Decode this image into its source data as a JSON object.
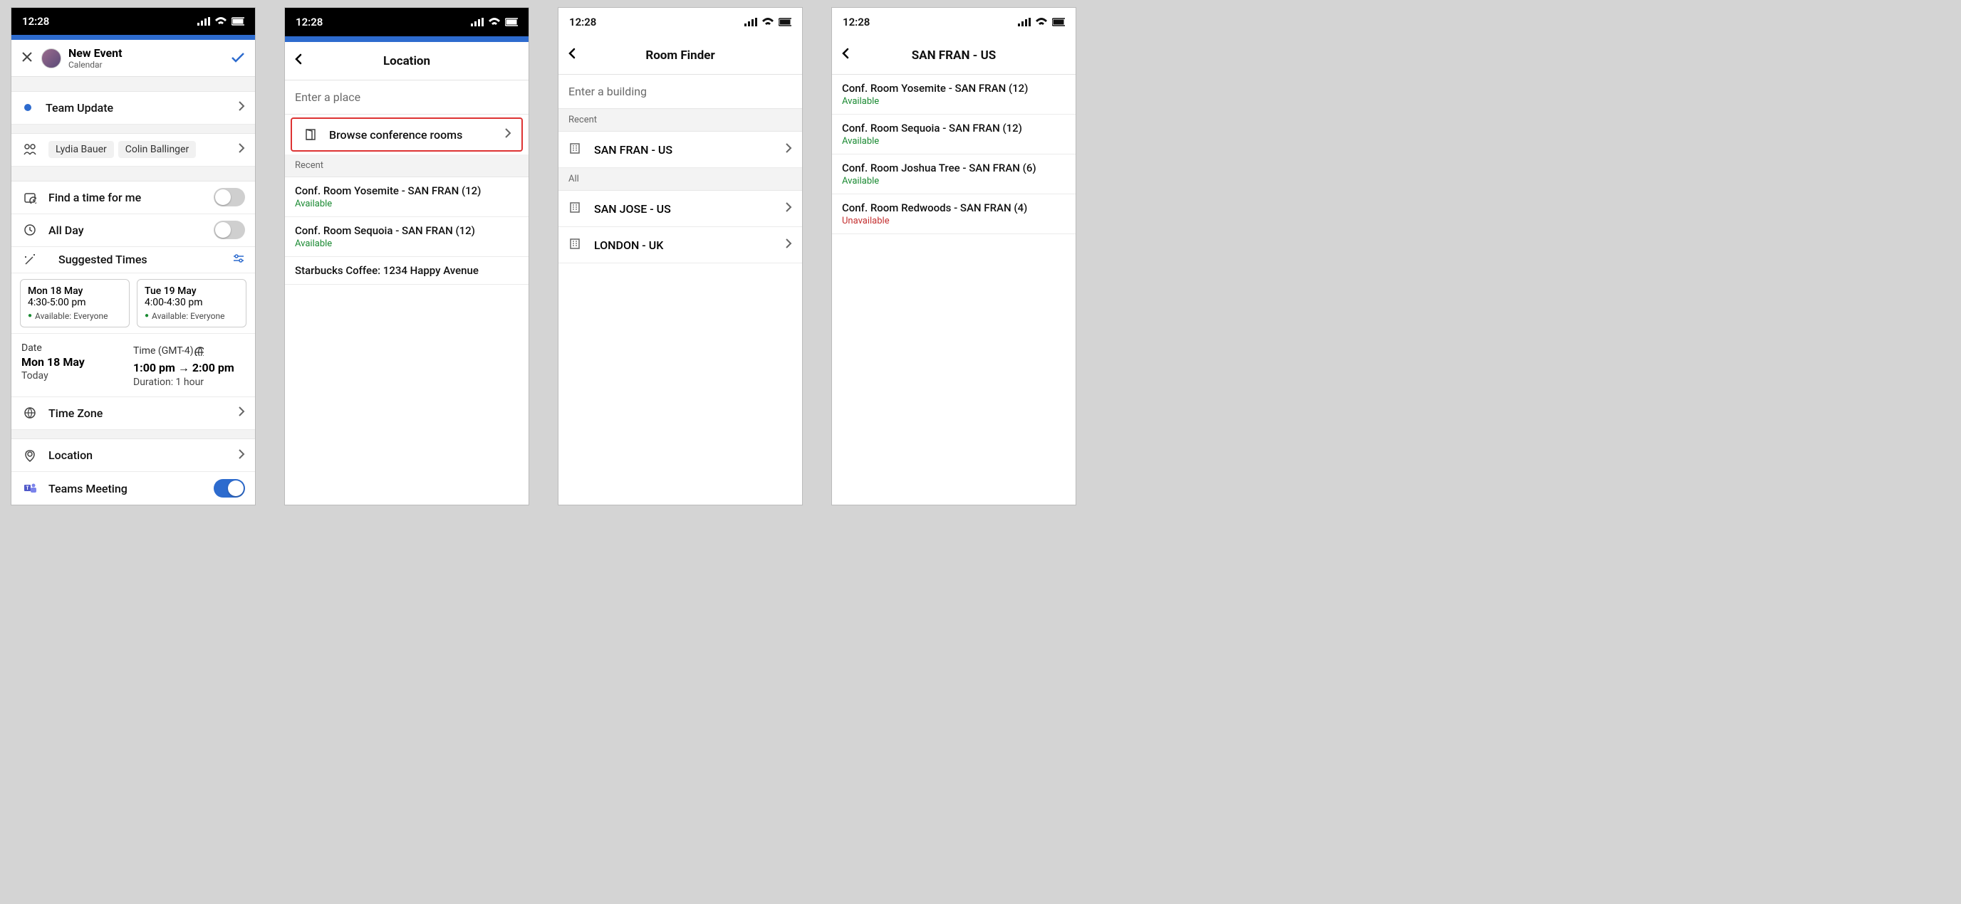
{
  "status_time": "12:28",
  "phone1": {
    "new_event_title": "New Event",
    "new_event_sub": "Calendar",
    "event_name": "Team Update",
    "attendee1": "Lydia Bauer",
    "attendee2": "Colin Ballinger",
    "find_time": "Find a time for me",
    "all_day": "All Day",
    "suggested": "Suggested Times",
    "card1_d": "Mon 18 May",
    "card1_t": "4:30-5:00 pm",
    "card1_a": "Available: Everyone",
    "card2_d": "Tue 19 May",
    "card2_t": "4:00-4:30 pm",
    "card2_a": "Available: Everyone",
    "date_label": "Date",
    "date_val": "Mon 18 May",
    "date_sub": "Today",
    "time_label": "Time (GMT-4)",
    "time_val": "1:00 pm → 2:00 pm",
    "time_sub": "Duration: 1 hour",
    "timezone": "Time Zone",
    "location": "Location",
    "teams": "Teams Meeting"
  },
  "phone2": {
    "title": "Location",
    "placeholder": "Enter a place",
    "browse": "Browse conference rooms",
    "recent": "Recent",
    "room1": "Conf. Room Yosemite - SAN FRAN (12)",
    "room1_s": "Available",
    "room2": "Conf. Room Sequoia - SAN FRAN (12)",
    "room2_s": "Available",
    "place3": "Starbucks Coffee: 1234 Happy Avenue"
  },
  "phone3": {
    "title": "Room Finder",
    "placeholder": "Enter a building",
    "recent": "Recent",
    "all": "All",
    "b1": "SAN FRAN - US",
    "b2": "SAN JOSE - US",
    "b3": "LONDON - UK"
  },
  "phone4": {
    "title": "SAN FRAN - US",
    "r1": "Conf. Room Yosemite - SAN FRAN (12)",
    "r1_s": "Available",
    "r2": "Conf. Room Sequoia - SAN FRAN (12)",
    "r2_s": "Available",
    "r3": "Conf. Room Joshua Tree - SAN FRAN (6)",
    "r3_s": "Available",
    "r4": "Conf. Room Redwoods - SAN FRAN (4)",
    "r4_s": "Unavailable"
  }
}
